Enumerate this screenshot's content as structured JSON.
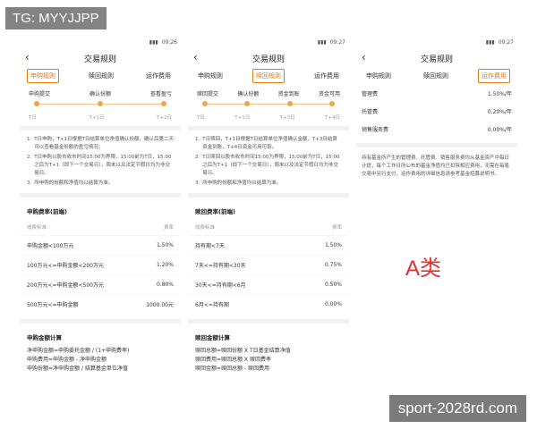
{
  "overlay": {
    "tag": "TG: MYYJJPP",
    "watermark": "sport-2028rd.com"
  },
  "panels": [
    {
      "time": "09:26",
      "title": "交易规则",
      "tabs": [
        "申购规则",
        "赎回规则",
        "运作费用"
      ],
      "active_tab": 0,
      "steps": [
        "申购提交",
        "确认份额",
        "查看盈亏"
      ],
      "step_days": [
        "T日",
        "T+1日",
        "T+2日"
      ],
      "notes": [
        "T日申购，T+1日根据T日结算单位净值确认份额，确认后第二天可以查看基金份额的盈亏情况；",
        "T日申购以股市收市时间15:00为界限，15:00前为T日，15:00之后为T+1（即下一个交易日），周末以及法定节假日均为非交易日。",
        "所申购的份额和净值均以结算为准。"
      ],
      "fee_title": "申购费率(前端)",
      "fee_head": [
        "收费标准",
        "费率"
      ],
      "fees": [
        [
          "申购金额<100万元",
          "1.50%"
        ],
        [
          "100万元<=申购金额<200万元",
          "1.20%"
        ],
        [
          "200万元<=申购金额<500万元",
          "0.80%"
        ],
        [
          "500万元<=申购金额",
          "1000.00元"
        ]
      ],
      "calc_title": "申购金额计算",
      "calc": [
        "净申购金额=申购委托金额 / (1+申购费率)",
        "申购费用=申购金额 - 净申购金额",
        "申购份额=净申购金额 / 结算基金单位净值"
      ]
    },
    {
      "time": "09:27",
      "title": "交易规则",
      "tabs": [
        "申购规则",
        "赎回规则",
        "运作费用"
      ],
      "active_tab": 1,
      "steps": [
        "赎回提交",
        "确认份额",
        "资金到账",
        "资金可用"
      ],
      "step_days": [
        "T日",
        "T+1日",
        "T+3日",
        "T+4日"
      ],
      "notes": [
        "T日赎回，T+1日根据T日结算单位净值确认金额，T+3日结算资金到账，T+4日资金可用可取。",
        "T日赎回以股市收市时间15:00为界限，15:00前为T日，15:00之后为T+1（即下一个交易日），周末以及法定节假日均为非交易日。",
        "所申购的份额和净值均以结算为准。"
      ],
      "fee_title": "赎回费率(前端)",
      "fee_head": [
        "收费标准",
        "费率"
      ],
      "fees": [
        [
          "持有期<7天",
          "1.50%"
        ],
        [
          "7天<=持有期<30天",
          "0.75%"
        ],
        [
          "30天<=持有期<6月",
          "0.50%"
        ],
        [
          "6月<=持有期",
          "0.00%"
        ]
      ],
      "calc_title": "赎回金额计算",
      "calc": [
        "赎回总额=赎回份额 X T日基金结算净值",
        "赎回费用=赎回总额 X 赎回费率",
        "赎回金额=赎回总额 - 赎回费用"
      ]
    },
    {
      "time": "09:27",
      "title": "交易规则",
      "tabs": [
        "申购规则",
        "赎回规则",
        "运作费用"
      ],
      "active_tab": 2,
      "mgmt": [
        [
          "管理费",
          "1.50%/年"
        ],
        [
          "托管费",
          "0.20%/年"
        ],
        [
          "销售服务费",
          "0.00%/年"
        ]
      ],
      "mgmt_note": "持有基金所产生的管理费、托管费、销售服务费均从基金资产中每日计提，每个工作日所公布的基金净值均已扣除相应费用，无需在每笔交易中另行支付，运作费用的详细信息请参考基金招募说明书。",
      "class_label": "A类"
    }
  ]
}
